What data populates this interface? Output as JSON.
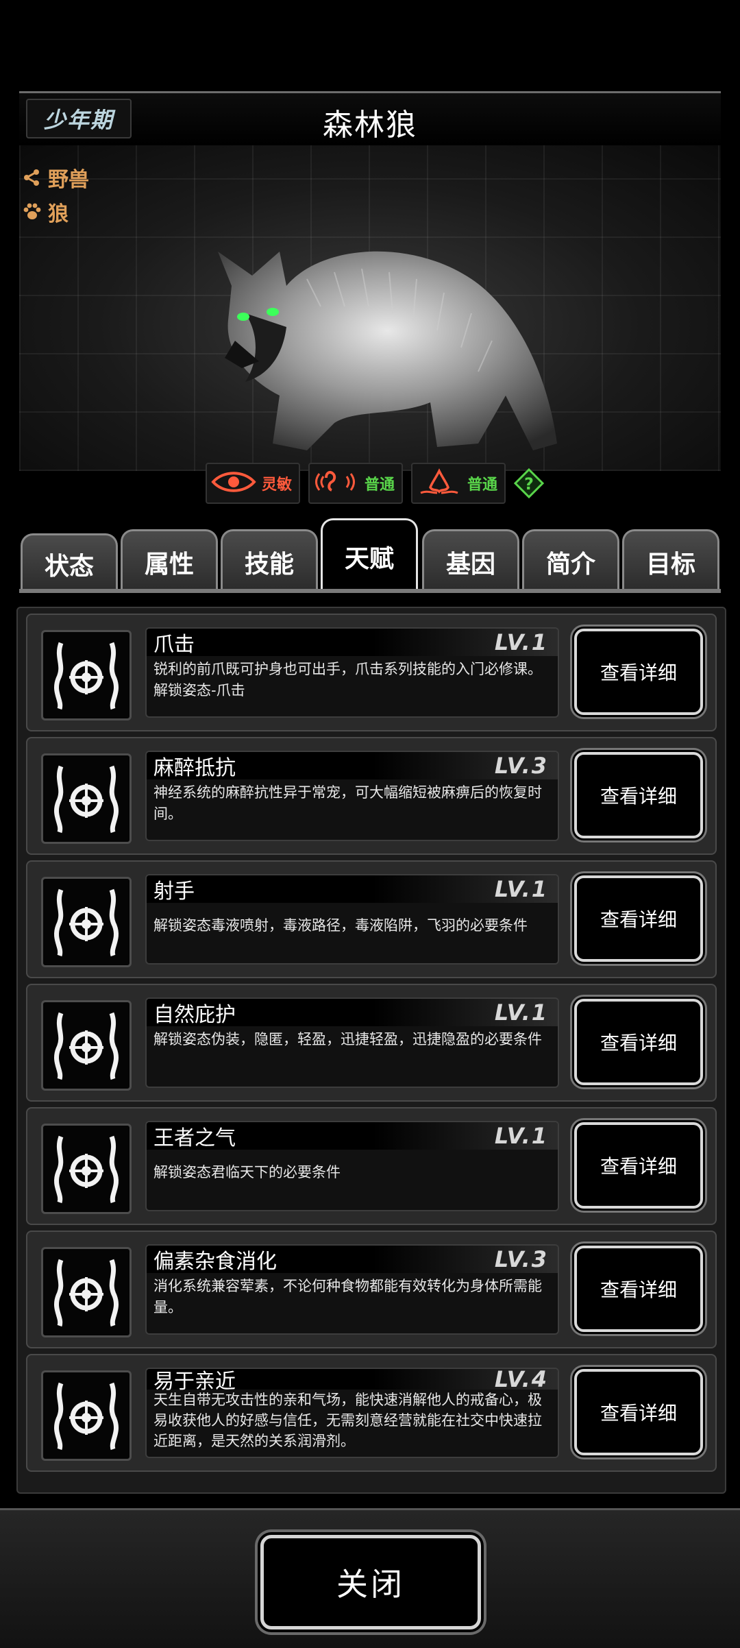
{
  "header": {
    "stage": "少年期",
    "title": "森林狼"
  },
  "tags": [
    {
      "icon": "share-node-icon",
      "label": "野兽"
    },
    {
      "icon": "paw-icon",
      "label": "狼"
    }
  ],
  "senses": [
    {
      "icon": "eye-icon",
      "label": "灵敏",
      "color": "#ff5a3c"
    },
    {
      "icon": "ear-icon",
      "label": "普通",
      "color": "#59d54a"
    },
    {
      "icon": "nose-icon",
      "label": "普通",
      "color": "#59d54a"
    }
  ],
  "tabs": [
    {
      "label": "状态",
      "active": false
    },
    {
      "label": "属性",
      "active": false
    },
    {
      "label": "技能",
      "active": false
    },
    {
      "label": "天赋",
      "active": true
    },
    {
      "label": "基因",
      "active": false
    },
    {
      "label": "简介",
      "active": false
    },
    {
      "label": "目标",
      "active": false
    }
  ],
  "talents": [
    {
      "name": "爪击",
      "level": "LV.1",
      "desc": "锐利的前爪既可护身也可出手，爪击系列技能的入门必修课。解锁姿态-爪击",
      "button": "查看详细"
    },
    {
      "name": "麻醉抵抗",
      "level": "LV.3",
      "desc": "神经系统的麻醉抗性异于常宠，可大幅缩短被麻痹后的恢复时间。",
      "button": "查看详细"
    },
    {
      "name": "射手",
      "level": "LV.1",
      "desc": "解锁姿态毒液喷射，毒液路径，毒液陷阱，飞羽的必要条件",
      "button": "查看详细"
    },
    {
      "name": "自然庇护",
      "level": "LV.1",
      "desc": "解锁姿态伪装，隐匿，轻盈，迅捷轻盈，迅捷隐盈的必要条件",
      "button": "查看详细"
    },
    {
      "name": "王者之气",
      "level": "LV.1",
      "desc": "解锁姿态君临天下的必要条件",
      "button": "查看详细"
    },
    {
      "name": "偏素杂食消化",
      "level": "LV.3",
      "desc": "消化系统兼容荤素，不论何种食物都能有效转化为身体所需能量。",
      "button": "查看详细"
    },
    {
      "name": "易于亲近",
      "level": "LV.4",
      "desc": "天生自带无攻击性的亲和气场，能快速消解他人的戒备心，极易收获他人的好感与信任，无需刻意经营就能在社交中快速拉近距离，是天然的关系润滑剂。",
      "button": "查看详细"
    }
  ],
  "footer": {
    "close_label": "关闭"
  }
}
